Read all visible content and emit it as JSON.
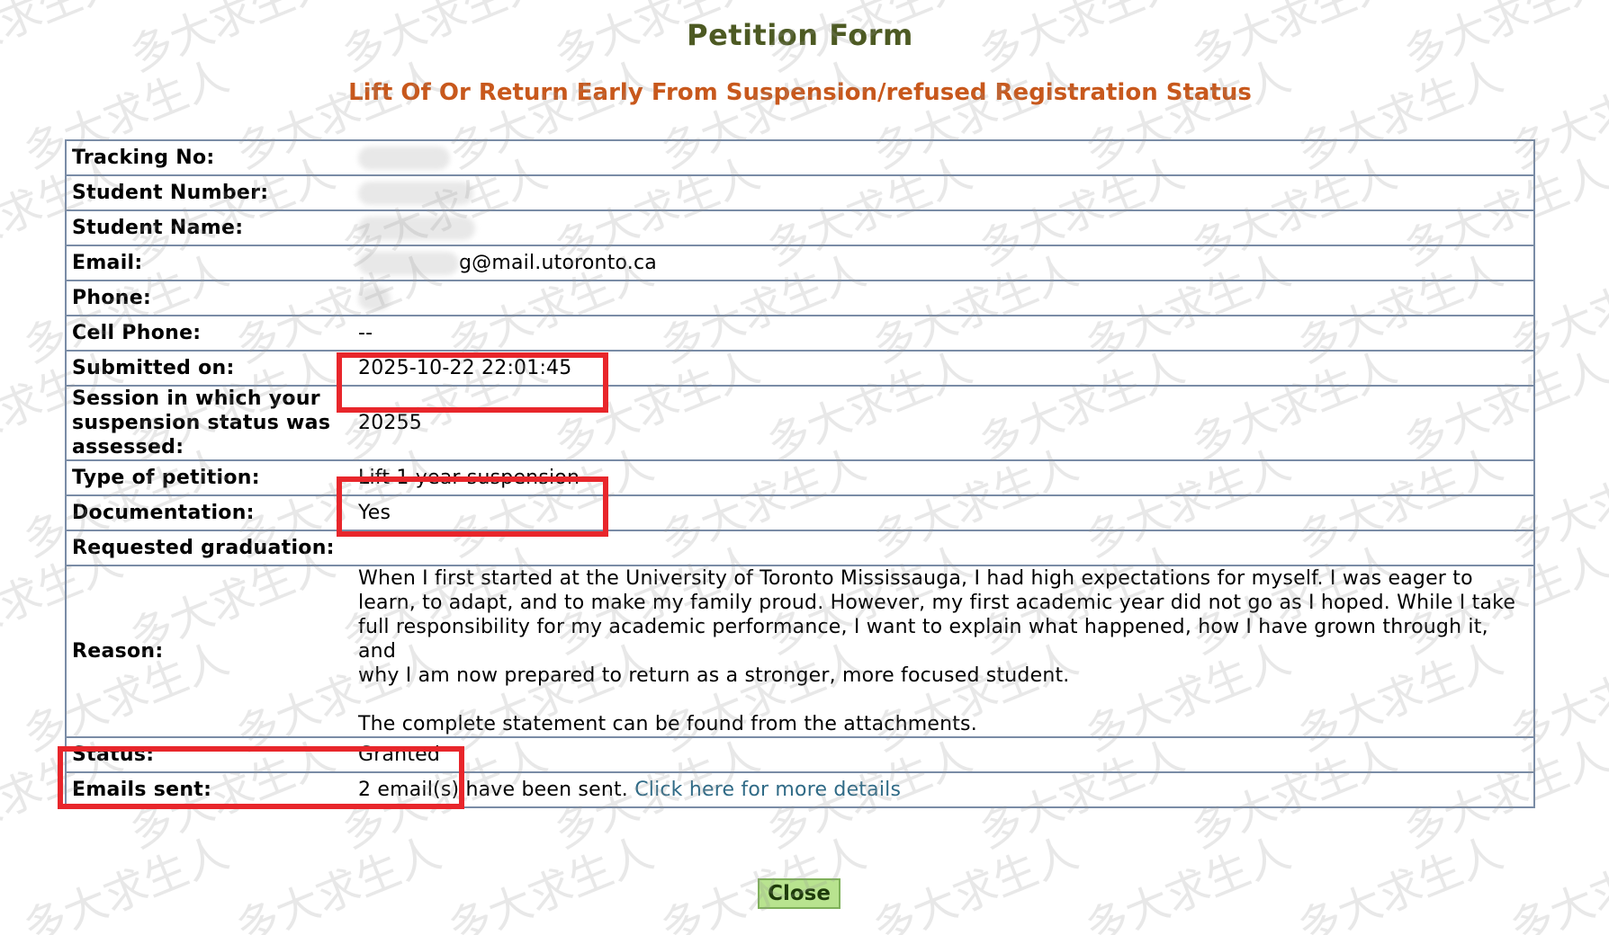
{
  "page": {
    "title": "Petition Form",
    "subtitle": "Lift Of Or Return Early From Suspension/refused Registration Status"
  },
  "form": {
    "tracking_no_label": "Tracking No:",
    "student_number_label": "Student Number:",
    "student_name_label": "Student Name:",
    "email_label": "Email:",
    "email_value": "g@mail.utoronto.ca",
    "phone_label": "Phone:",
    "cell_phone_label": "Cell Phone:",
    "cell_phone_value": "--",
    "submitted_on_label": "Submitted on:",
    "submitted_on_value": "2025-10-22 22:01:45",
    "session_label_line1": "Session in which your",
    "session_label_line2": "suspension status was",
    "session_label_line3": "assessed:",
    "session_value": "20255",
    "petition_type_label": "Type of petition:",
    "petition_type_value": "Lift 1 year suspension",
    "documentation_label": "Documentation:",
    "documentation_value": "Yes",
    "requested_graduation_label": "Requested graduation:",
    "reason_label": "Reason:",
    "reason_line1": "When I first started at the University of Toronto Mississauga, I had high expectations for myself. I was eager to",
    "reason_line2": "learn, to adapt, and to make my family proud. However, my first academic year did not go as I hoped. While I take",
    "reason_line3": "full responsibility for my academic performance, I want to explain what happened, how I have grown through it, and",
    "reason_line4": "why I am now prepared to return as a stronger, more focused student.",
    "reason_line5": "The complete statement can be found from the attachments.",
    "status_label": "Status:",
    "status_value": "Granted",
    "emails_sent_label": "Emails sent:",
    "emails_sent_value": "2 email(s) have been sent.",
    "details_link": "Click here for more details"
  },
  "buttons": {
    "close_label": "Close"
  },
  "watermark": {
    "text": "多大求生人"
  },
  "colors": {
    "title": "#4d5a23",
    "subtitle": "#c8581c",
    "table_border": "#7a8ca6",
    "highlight": "#e8262b",
    "link": "#2f6a86",
    "close_button_bg": "#b8e38f"
  }
}
